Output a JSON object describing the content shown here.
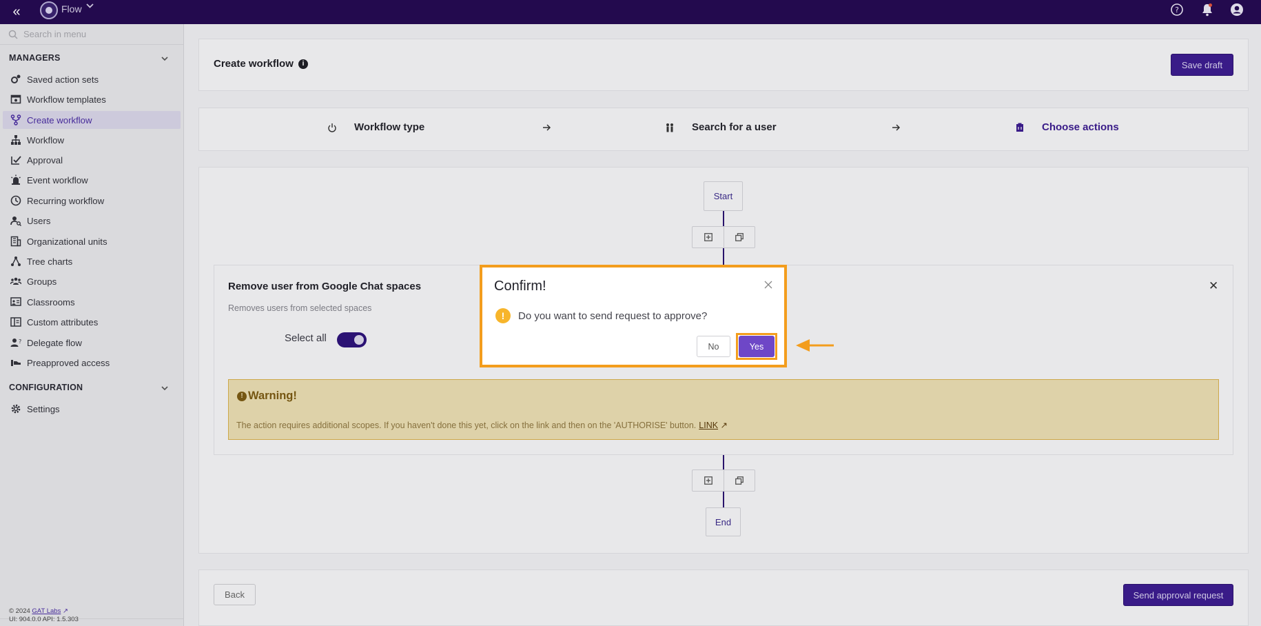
{
  "app": {
    "name": "Flow"
  },
  "sidebar": {
    "search_placeholder": "Search in menu",
    "managers_title": "MANAGERS",
    "items": [
      {
        "label": "Saved action sets",
        "icon": "gears-icon"
      },
      {
        "label": "Workflow templates",
        "icon": "template-icon"
      },
      {
        "label": "Create workflow",
        "icon": "branch-icon",
        "active": true
      },
      {
        "label": "Workflow",
        "icon": "sitemap-icon"
      },
      {
        "label": "Approval",
        "icon": "approval-icon"
      },
      {
        "label": "Event workflow",
        "icon": "siren-icon"
      },
      {
        "label": "Recurring workflow",
        "icon": "clock-icon"
      },
      {
        "label": "Users",
        "icon": "user-search-icon"
      },
      {
        "label": "Organizational units",
        "icon": "building-icon"
      },
      {
        "label": "Tree charts",
        "icon": "tree-icon"
      },
      {
        "label": "Groups",
        "icon": "groups-icon"
      },
      {
        "label": "Classrooms",
        "icon": "classroom-icon"
      },
      {
        "label": "Custom attributes",
        "icon": "attributes-icon"
      },
      {
        "label": "Delegate flow",
        "icon": "delegate-icon"
      },
      {
        "label": "Preapproved access",
        "icon": "preapproved-icon"
      }
    ],
    "configuration_title": "CONFIGURATION",
    "config_items": [
      {
        "label": "Settings",
        "icon": "gear-icon"
      }
    ],
    "footer": {
      "copyright": "© 2024",
      "company_link": "GAT Labs",
      "version": "UI: 904.0.0 API: 1.5.303"
    }
  },
  "header": {
    "title": "Create workflow",
    "save_draft": "Save draft"
  },
  "steps": [
    {
      "label": "Workflow type"
    },
    {
      "label": "Search for a user"
    },
    {
      "label": "Choose actions"
    }
  ],
  "flow": {
    "start_label": "Start",
    "end_label": "End"
  },
  "action_card": {
    "title": "Remove user from Google Chat spaces",
    "description": "Removes users from selected spaces",
    "select_all_label": "Select all",
    "warning_title": "Warning!",
    "warning_text": "The action requires additional scopes. If you haven't done this yet, click on the link and then on the 'AUTHORISE' button.",
    "warning_link": "LINK"
  },
  "footer_bar": {
    "back": "Back",
    "send_approval": "Send approval request"
  },
  "modal": {
    "title": "Confirm!",
    "message": "Do you want to send request to approve?",
    "no": "No",
    "yes": "Yes"
  },
  "colors": {
    "topbar": "#250b52",
    "primary": "#3c1d8e",
    "highlight": "#f39d1d",
    "yes_button": "#6e47c7"
  }
}
